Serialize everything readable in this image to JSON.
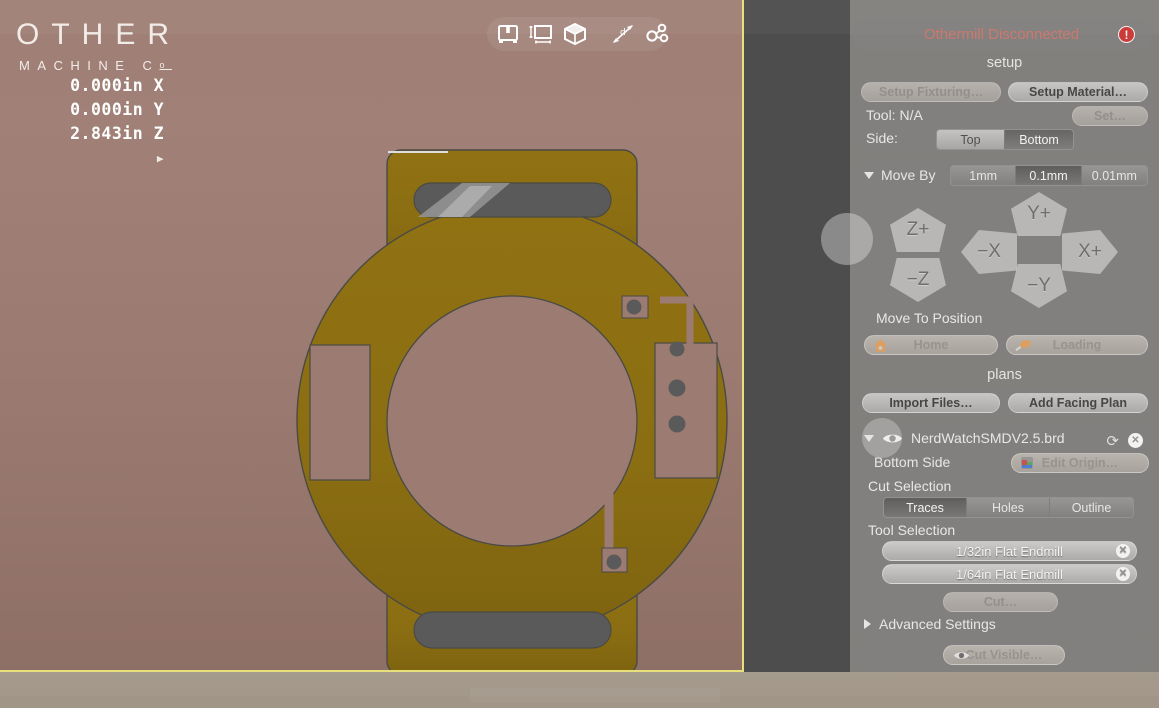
{
  "logo": {
    "line1": "OTHER",
    "line2": "MACHINE C",
    "line2_sup": "o"
  },
  "readout": {
    "x": "0.000in X",
    "y": "0.000in Y",
    "z": "2.843in Z",
    "expander": "▶"
  },
  "viewport_toolbar": [
    {
      "name": "bookmark-view-icon",
      "label": "bookmark-view"
    },
    {
      "name": "measure-frame-icon",
      "label": "measure-frame"
    },
    {
      "name": "cube-3d-icon",
      "label": "cube-3d"
    },
    {
      "name": "divider",
      "label": "|"
    },
    {
      "name": "dimension-arrows-icon",
      "label": "dimension-arrows"
    },
    {
      "name": "node-path-icon",
      "label": "node-path"
    }
  ],
  "status": {
    "text": "Othermill Disconnected",
    "badge": "!",
    "badge_color": "#cf2020",
    "text_color": "#d16b60"
  },
  "setup": {
    "title": "setup",
    "setup_fixturing": "Setup Fixturing…",
    "setup_material": "Setup Material…",
    "tool_label": "Tool: N/A",
    "set_button": "Set…",
    "side_label": "Side:",
    "side_options": [
      "Top",
      "Bottom"
    ],
    "side_selected": "Bottom"
  },
  "move_by": {
    "title": "Move By",
    "disclosure": "▼",
    "step_options": [
      "1mm",
      "0.1mm",
      "0.01mm"
    ],
    "step_selected": "0.1mm",
    "jog": {
      "z_plus": "Z+",
      "z_minus": "−Z",
      "y_plus": "Y+",
      "y_minus": "−Y",
      "x_plus": "X+",
      "x_minus": "−X"
    },
    "move_to_position": "Move To Position",
    "home_button": "Home",
    "loading_button": "Loading"
  },
  "plans": {
    "title": "plans",
    "import_files": "Import Files…",
    "add_facing_plan": "Add Facing Plan",
    "file": {
      "disclosure": "▼",
      "visibility_icon": "eye-icon",
      "name": "NerdWatchSMDV2.5.brd",
      "refresh_icon": "refresh-icon",
      "close_icon": "close-icon",
      "side": "Bottom Side",
      "edit_origin": "Edit Origin…"
    },
    "cut_selection_label": "Cut Selection",
    "cut_selection_options": [
      "Traces",
      "Holes",
      "Outline"
    ],
    "cut_selection_selected": "Traces",
    "tool_selection_label": "Tool Selection",
    "tools": [
      "1/32in Flat Endmill",
      "1/64in Flat Endmill"
    ],
    "cut_button": "Cut…",
    "advanced_settings": "Advanced Settings",
    "advanced_disclosure": "▶",
    "cut_visible": "Cut Visible…"
  },
  "colors": {
    "viewport_bg_top": "#9f7f75",
    "viewport_bg_bottom": "#8e6f66",
    "board_copper": "#8d7014",
    "board_copper_shade": "#8a6d12",
    "pad_gray": "#5a5a5a",
    "accent_yellow": "#e8e07a",
    "panel_dark": "#4d4d4d",
    "footer": "#a3988a"
  },
  "board": {
    "name": "NerdWatch PCB bottom side",
    "outline": "circular watch body with top and bottom lugs",
    "features": [
      "top lug slot pad",
      "bottom lug slot pad",
      "center circular cutout",
      "left rectangular cutout",
      "right rectangular pad with three holes",
      "trace from top-right pad to right pad column",
      "long vertical trace to bottom-center pad"
    ]
  }
}
